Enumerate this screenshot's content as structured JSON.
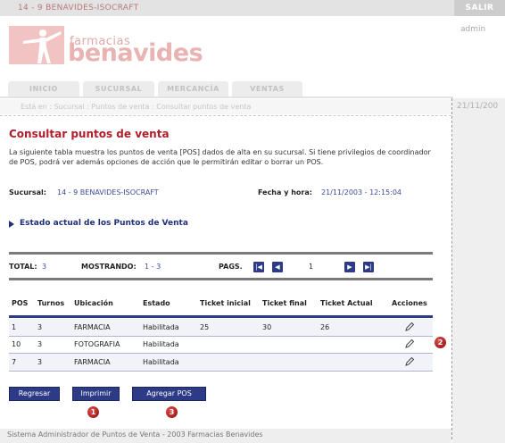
{
  "topbar": {
    "store": "14 - 9    BENAVIDES-ISOCRAFT",
    "logout": "SALIR"
  },
  "logo": {
    "small": "farmacias",
    "big": "benavides"
  },
  "user": "admin",
  "nav": {
    "tabs": [
      "INICIO",
      "SUCURSAL",
      "MERCANCÍA",
      "VENTAS"
    ]
  },
  "breadcrumb": {
    "text": "Está en : Sucursal : Puntos de venta : Consultar puntos de venta",
    "date": "21/11/200"
  },
  "page": {
    "title": "Consultar puntos de venta",
    "description": "La siguiente tabla muestra los puntos de venta [POS] dados de alta en su sucursal. Si tiene privilegios de coordinador de POS, podrá ver además opciones de acción que le permitirán editar o borrar un POS."
  },
  "info": {
    "sucursal_label": "Sucursal:",
    "sucursal_value": "14 - 9   BENAVIDES-ISOCRAFT",
    "fecha_label": "Fecha y hora:",
    "fecha_value": "21/11/2003 - 12:15:04"
  },
  "section_title": "Estado actual de los Puntos de Venta",
  "paging": {
    "total_label": "TOTAL:",
    "total_value": "3",
    "showing_label": "MOSTRANDO:",
    "showing_value": "1 - 3",
    "pages_label": "PAGS.",
    "page": "1"
  },
  "table": {
    "columns": [
      "POS",
      "Turnos",
      "Ubicación",
      "Estado",
      "Ticket inicial",
      "Ticket final",
      "Ticket Actual",
      "Acciones"
    ],
    "rows": [
      {
        "pos": "1",
        "turnos": "3",
        "ubicacion": "FARMACIA",
        "estado": "Habilitada",
        "inicial": "25",
        "final": "30",
        "actual": "26"
      },
      {
        "pos": "10",
        "turnos": "3",
        "ubicacion": "FOTOGRAFIA",
        "estado": "Habilitada",
        "inicial": "",
        "final": "",
        "actual": ""
      },
      {
        "pos": "7",
        "turnos": "3",
        "ubicacion": "FARMACIA",
        "estado": "Habilitada",
        "inicial": "",
        "final": "",
        "actual": ""
      }
    ]
  },
  "buttons": {
    "back": "Regresar",
    "print": "Imprimir",
    "add": "Agregar POS"
  },
  "badges": [
    "1",
    "2",
    "3"
  ],
  "footer": "Sistema Administrador de Puntos de Venta - 2003 Farmacias Benavides",
  "colors": {
    "accent": "#2d3b86",
    "title": "#b11d2a",
    "badge": "#b01818"
  }
}
